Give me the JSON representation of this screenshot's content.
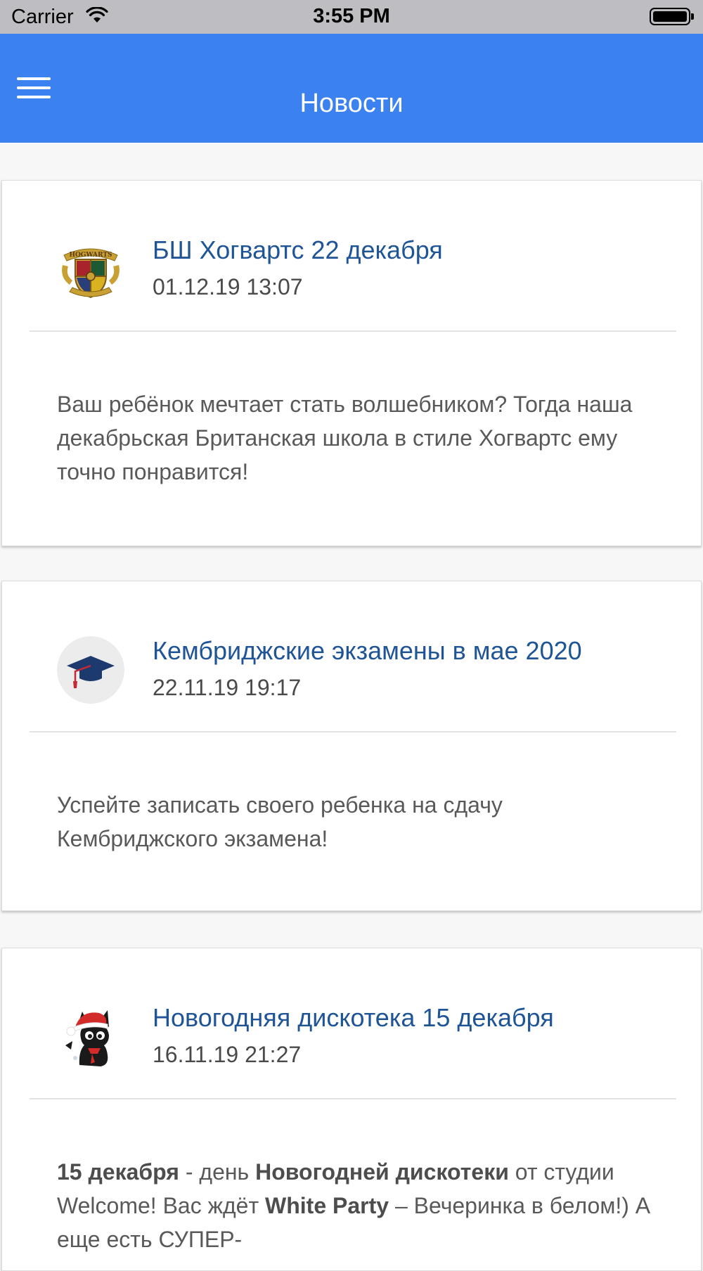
{
  "status_bar": {
    "carrier": "Carrier",
    "time": "3:55 PM"
  },
  "header": {
    "title": "Новости",
    "menu_icon": "hamburger-menu-icon",
    "color": "#3b82f0"
  },
  "news": [
    {
      "title": "БШ Хогвартс 22 декабря",
      "date": "01.12.19 13:07",
      "avatar": "hogwarts-crest",
      "body": "Ваш ребёнок мечтает стать волшебником? Тогда наша декабрьская Британская школа в стиле Хогвартс ему точно понравится!"
    },
    {
      "title": "Кембриджские экзамены в мае 2020",
      "date": "22.11.19 19:17",
      "avatar": "graduation-cap",
      "body": "Успейте записать своего ребенка на сдачу Кембриджского экзамена!"
    },
    {
      "title": "Новогодняя дискотека 15 декабря",
      "date": "16.11.19 21:27",
      "avatar": "santa-cat",
      "body_parts": {
        "b1": "15 декабря",
        "t1": " - день ",
        "b2": "Новогодней дискотеки",
        "t2": " от студии Welcome! Вас ждёт ",
        "b3": "White Party",
        "t3": " – Вечеринка в белом!) А еще есть СУПЕР-"
      }
    }
  ],
  "colors": {
    "title_link": "#1f5596",
    "background": "#f7f7f7"
  }
}
